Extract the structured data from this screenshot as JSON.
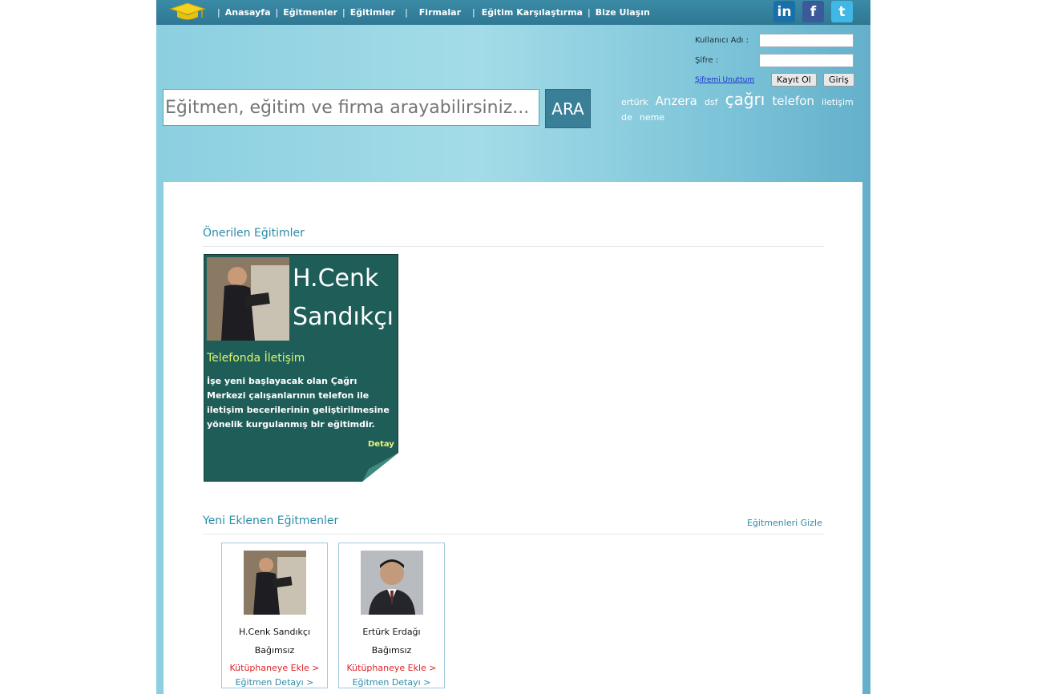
{
  "nav": {
    "items": [
      "Anasayfa",
      "Eğitmenler",
      "Eğitimler",
      "Firmalar",
      "Eğitim Karşılaştırma",
      "Bize Ulaşın"
    ],
    "social": [
      {
        "icon": "linkedin-icon",
        "glyph": "in"
      },
      {
        "icon": "facebook-icon",
        "glyph": "f"
      },
      {
        "icon": "twitter-icon",
        "glyph": "t"
      }
    ]
  },
  "login": {
    "username_label": "Kullanıcı Adı :",
    "password_label": "Şifre :",
    "username_value": "",
    "password_value": "",
    "forgot_label": "Şifremi Unuttum",
    "register_label": "Kayıt Ol",
    "login_label": "Giriş"
  },
  "search": {
    "placeholder": "Eğitmen, eğitim ve firma arayabilirsiniz...",
    "button_label": "ARA"
  },
  "tags": [
    {
      "text": "ertürk",
      "size": 11
    },
    {
      "text": "Anzera",
      "size": 15
    },
    {
      "text": "dsf",
      "size": 11
    },
    {
      "text": "çağrı",
      "size": 20
    },
    {
      "text": "telefon",
      "size": 15
    },
    {
      "text": "iletişim",
      "size": 11
    },
    {
      "text": "de",
      "size": 11
    },
    {
      "text": "neme",
      "size": 11
    }
  ],
  "recommended": {
    "title": "Önerilen Eğitimler",
    "card": {
      "trainer_name": "H.Cenk Sandıkçı",
      "course": "Telefonda İletişim",
      "description": "İşe yeni başlayacak olan Çağrı Merkezi çalışanlarının telefon ile iletişim becerilerinin geliştirilmesine yönelik kurgulanmış bir eğitimdir.",
      "detail_label": "Detay"
    }
  },
  "new_trainers": {
    "title": "Yeni Eklenen Eğitmenler",
    "hide_label": "Eğitmenleri Gizle",
    "items": [
      {
        "name": "H.Cenk Sandıkçı",
        "affiliation": "Bağımsız",
        "library_label": "Kütüphaneye Ekle >",
        "detail_label": "Eğitmen Detayı >"
      },
      {
        "name": "Ertürk Erdağı",
        "affiliation": "Bağımsız",
        "library_label": "Kütüphaneye Ekle >",
        "detail_label": "Eğitmen Detayı >"
      }
    ]
  }
}
